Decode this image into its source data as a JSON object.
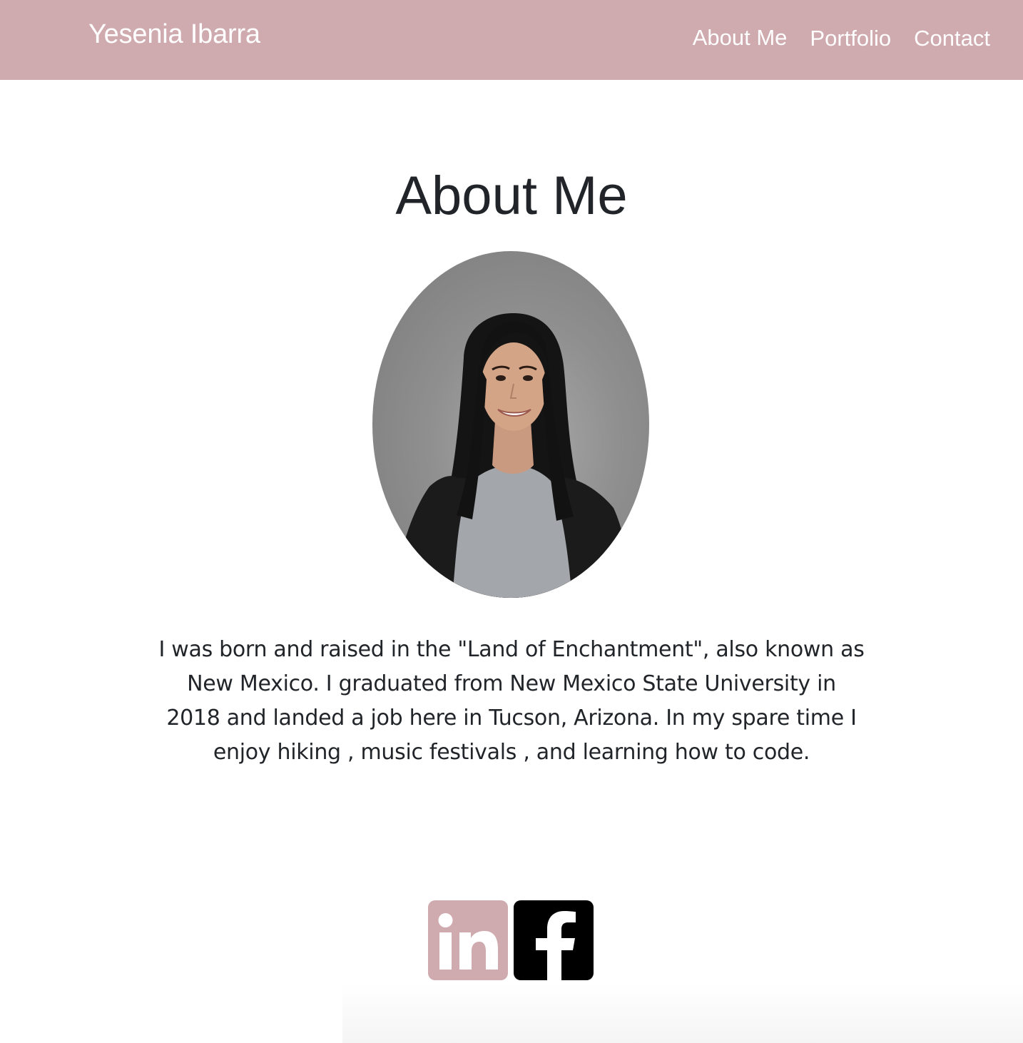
{
  "navbar": {
    "brand": "Yesenia Ibarra",
    "links": [
      {
        "label": "About Me"
      },
      {
        "label": "Portfolio"
      },
      {
        "label": "Contact"
      }
    ],
    "background": "#cfaaae"
  },
  "main": {
    "title": "About Me",
    "bio": "I was born and raised in the \"Land of Enchantment\", also known as New Mexico. I graduated from New Mexico State University in 2018 and landed a job here in Tucson, Arizona. In my spare time I enjoy hiking , music festivals , and learning how to code."
  },
  "socials": [
    {
      "icon": "linkedin-icon",
      "color": "#cfaaae"
    },
    {
      "icon": "facebook-icon",
      "color": "#000000"
    }
  ],
  "colors": {
    "accent": "#cfaaae",
    "text": "#212529"
  }
}
